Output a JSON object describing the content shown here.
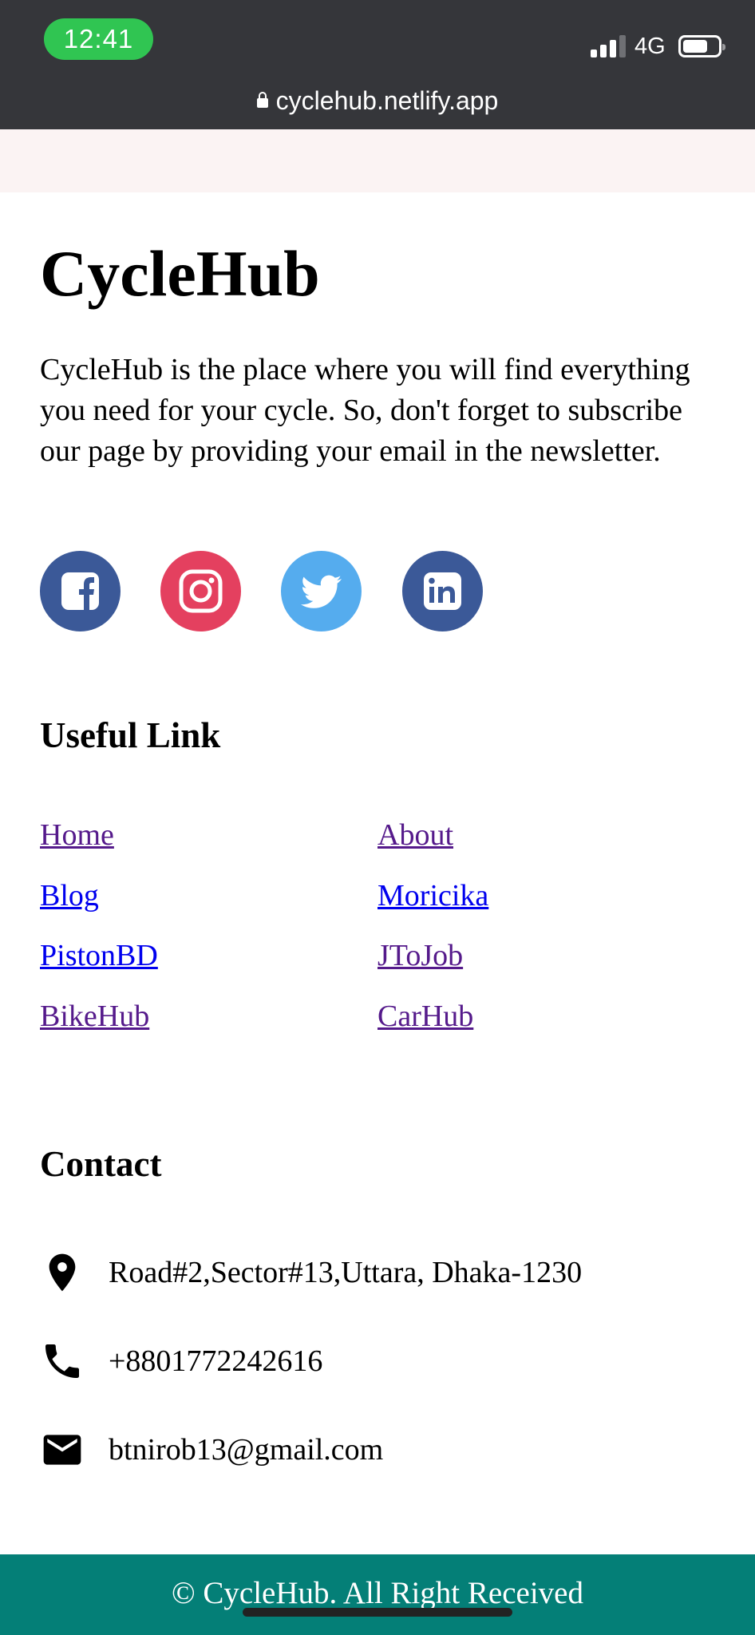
{
  "status_bar": {
    "time": "12:41",
    "network": "4G",
    "url": "cyclehub.netlify.app"
  },
  "brand": {
    "title": "CycleHub",
    "description": "CycleHub is the place where you will find everything you need for your cycle. So, don't forget to subscribe our page by providing your email in the newsletter."
  },
  "social": [
    {
      "icon": "facebook-icon",
      "color": "#3b5998"
    },
    {
      "icon": "instagram-icon",
      "color": "#e4405f"
    },
    {
      "icon": "twitter-icon",
      "color": "#55acee"
    },
    {
      "icon": "linkedin-icon",
      "color": "#3b5998"
    }
  ],
  "useful_links": {
    "heading": "Useful Link",
    "items": [
      "Home",
      "About",
      "Blog",
      "Moricika",
      "PistonBD",
      "JToJob",
      "BikeHub",
      "CarHub"
    ]
  },
  "contact": {
    "heading": "Contact",
    "address": "Road#2,Sector#13,Uttara, Dhaka-1230",
    "phone": "+8801772242616",
    "email": "btnirob13@gmail.com"
  },
  "footer": {
    "text": "© CycleHub. All Right Received"
  },
  "colors": {
    "status_bar": "#35363a",
    "time_pill": "#30c552",
    "footer": "#047f77",
    "visited_link": "#551a8b",
    "link": "#0000ee"
  }
}
